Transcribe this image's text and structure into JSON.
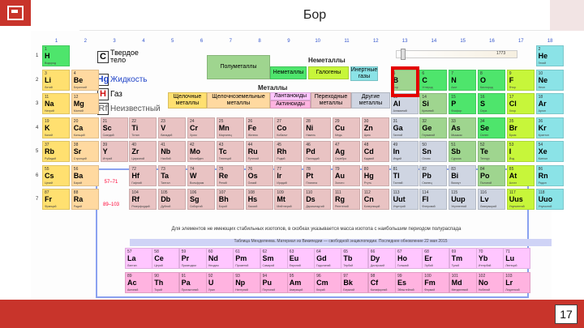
{
  "title": "Бор",
  "page_number": "17",
  "logo_icon": "periodic-chip-icon",
  "highlight_color": "#e40000",
  "slider_value": "1773",
  "state_legend": [
    {
      "symbol": "C",
      "label_line1": "Твердое",
      "label_line2": "тело"
    },
    {
      "symbol": "Hg",
      "label_line1": "Жидкость"
    },
    {
      "symbol": "H",
      "label_line1": "Газ"
    },
    {
      "symbol": "Rf",
      "label_line1": "Неизвестный"
    }
  ],
  "nonmetals_label": "Неметаллы",
  "metals_label": "Металлы",
  "categories": {
    "semimetals": "Полуметаллы",
    "other_nonmetals": "Неметаллы",
    "halogens": "Галогены",
    "noble_gases": "Инертные газы",
    "alkali": "Щелочные металлы",
    "alkaline_earth": "Щелочноземельные металлы",
    "lanthanides": "Лантаноиды",
    "actinides": "Актиноиды",
    "transition": "Переходные металлы",
    "other_metals": "Другие металлы"
  },
  "groups": [
    "1",
    "2",
    "3",
    "4",
    "5",
    "6",
    "7",
    "8",
    "9",
    "10",
    "11",
    "12",
    "13",
    "14",
    "15",
    "16",
    "17",
    "18"
  ],
  "periods": [
    "1",
    "2",
    "3",
    "4",
    "5",
    "6",
    "7"
  ],
  "la_label": "57–71",
  "ac_label": "89–103",
  "note": "Для элементов не имеющих стабильных изотопов, в скобках указывается масса изотопа с наибольшим периодом полураспада",
  "source": "Таблица Менделеева. Материал из Википедии — свободной энциклопедии. Последнее обновление 22 мая 2015",
  "rows": [
    [
      [
        "1",
        "H",
        "Водород"
      ],
      null,
      null,
      null,
      null,
      null,
      null,
      null,
      null,
      null,
      null,
      null,
      null,
      null,
      null,
      null,
      null,
      [
        "2",
        "He",
        "Гелий"
      ]
    ],
    [
      [
        "3",
        "Li",
        "Литий"
      ],
      [
        "4",
        "Be",
        "Бериллий"
      ],
      null,
      null,
      null,
      null,
      null,
      null,
      null,
      null,
      null,
      null,
      [
        "5",
        "B",
        "Бор"
      ],
      [
        "6",
        "C",
        "Углерод"
      ],
      [
        "7",
        "N",
        "Азот"
      ],
      [
        "8",
        "O",
        "Кислород"
      ],
      [
        "9",
        "F",
        "Фтор"
      ],
      [
        "10",
        "Ne",
        "Неон"
      ]
    ],
    [
      [
        "11",
        "Na",
        "Натрий"
      ],
      [
        "12",
        "Mg",
        "Магний"
      ],
      null,
      null,
      null,
      null,
      null,
      null,
      null,
      null,
      null,
      null,
      [
        "13",
        "Al",
        "Алюминий"
      ],
      [
        "14",
        "Si",
        "Кремний"
      ],
      [
        "15",
        "P",
        "Фосфор"
      ],
      [
        "16",
        "S",
        "Сера"
      ],
      [
        "17",
        "Cl",
        "Хлор"
      ],
      [
        "18",
        "Ar",
        "Аргон"
      ]
    ],
    [
      [
        "19",
        "K",
        "Калий"
      ],
      [
        "20",
        "Ca",
        "Кальций"
      ],
      [
        "21",
        "Sc",
        "Скандий"
      ],
      [
        "22",
        "Ti",
        "Титан"
      ],
      [
        "23",
        "V",
        "Ванадий"
      ],
      [
        "24",
        "Cr",
        "Хром"
      ],
      [
        "25",
        "Mn",
        "Марганец"
      ],
      [
        "26",
        "Fe",
        "Железо"
      ],
      [
        "27",
        "Co",
        "Кобальт"
      ],
      [
        "28",
        "Ni",
        "Никель"
      ],
      [
        "29",
        "Cu",
        "Медь"
      ],
      [
        "30",
        "Zn",
        "Цинк"
      ],
      [
        "31",
        "Ga",
        "Галлий"
      ],
      [
        "32",
        "Ge",
        "Германий"
      ],
      [
        "33",
        "As",
        "Мышьяк"
      ],
      [
        "34",
        "Se",
        "Селен"
      ],
      [
        "35",
        "Br",
        "Бром"
      ],
      [
        "36",
        "Kr",
        "Криптон"
      ]
    ],
    [
      [
        "37",
        "Rb",
        "Рубидий"
      ],
      [
        "38",
        "Sr",
        "Стронций"
      ],
      [
        "39",
        "Y",
        "Иттрий"
      ],
      [
        "40",
        "Zr",
        "Цирконий"
      ],
      [
        "41",
        "Nb",
        "Ниобий"
      ],
      [
        "42",
        "Mo",
        "Молибден"
      ],
      [
        "43",
        "Tc",
        "Технеций"
      ],
      [
        "44",
        "Ru",
        "Рутений"
      ],
      [
        "45",
        "Rh",
        "Родий"
      ],
      [
        "46",
        "Pd",
        "Палладий"
      ],
      [
        "47",
        "Ag",
        "Серебро"
      ],
      [
        "48",
        "Cd",
        "Кадмий"
      ],
      [
        "49",
        "In",
        "Индий"
      ],
      [
        "50",
        "Sn",
        "Олово"
      ],
      [
        "51",
        "Sb",
        "Сурьма"
      ],
      [
        "52",
        "Te",
        "Теллур"
      ],
      [
        "53",
        "I",
        "Йод"
      ],
      [
        "54",
        "Xe",
        "Ксенон"
      ]
    ],
    [
      [
        "55",
        "Cs",
        "Цезий"
      ],
      [
        "56",
        "Ba",
        "Барий"
      ],
      null,
      [
        "72",
        "Hf",
        "Гафний"
      ],
      [
        "73",
        "Ta",
        "Тантал"
      ],
      [
        "74",
        "W",
        "Вольфрам"
      ],
      [
        "75",
        "Re",
        "Рений"
      ],
      [
        "76",
        "Os",
        "Осмий"
      ],
      [
        "77",
        "Ir",
        "Иридий"
      ],
      [
        "78",
        "Pt",
        "Платина"
      ],
      [
        "79",
        "Au",
        "Золото"
      ],
      [
        "80",
        "Hg",
        "Ртуть"
      ],
      [
        "81",
        "Tl",
        "Таллий"
      ],
      [
        "82",
        "Pb",
        "Свинец"
      ],
      [
        "83",
        "Bi",
        "Висмут"
      ],
      [
        "84",
        "Po",
        "Полоний"
      ],
      [
        "85",
        "At",
        "Астат"
      ],
      [
        "86",
        "Rn",
        "Радон"
      ]
    ],
    [
      [
        "87",
        "Fr",
        "Франций"
      ],
      [
        "88",
        "Ra",
        "Радий"
      ],
      null,
      [
        "104",
        "Rf",
        "Резерфордий"
      ],
      [
        "105",
        "Db",
        "Дубний"
      ],
      [
        "106",
        "Sg",
        "Сиборгий"
      ],
      [
        "107",
        "Bh",
        "Борий"
      ],
      [
        "108",
        "Hs",
        "Хассий"
      ],
      [
        "109",
        "Mt",
        "Мейтнерий"
      ],
      [
        "110",
        "Ds",
        "Дармштадтий"
      ],
      [
        "111",
        "Rg",
        "Рентгений"
      ],
      [
        "112",
        "Cn",
        "Коперниций"
      ],
      [
        "113",
        "Uut",
        "Унунтрий"
      ],
      [
        "114",
        "Fl",
        "Флеровий"
      ],
      [
        "115",
        "Uup",
        "Унунпентий"
      ],
      [
        "116",
        "Lv",
        "Ливерморий"
      ],
      [
        "117",
        "Uus",
        "Унунсептий"
      ],
      [
        "118",
        "Uuo",
        "Унуноктий"
      ]
    ]
  ],
  "lanthanides": [
    [
      "57",
      "La",
      "Лантан"
    ],
    [
      "58",
      "Ce",
      "Церий"
    ],
    [
      "59",
      "Pr",
      "Празеодим"
    ],
    [
      "60",
      "Nd",
      "Неодим"
    ],
    [
      "61",
      "Pm",
      "Прометий"
    ],
    [
      "62",
      "Sm",
      "Самарий"
    ],
    [
      "63",
      "Eu",
      "Европий"
    ],
    [
      "64",
      "Gd",
      "Гадолиний"
    ],
    [
      "65",
      "Tb",
      "Тербий"
    ],
    [
      "66",
      "Dy",
      "Диспрозий"
    ],
    [
      "67",
      "Ho",
      "Гольмий"
    ],
    [
      "68",
      "Er",
      "Эрбий"
    ],
    [
      "69",
      "Tm",
      "Тулий"
    ],
    [
      "70",
      "Yb",
      "Иттербий"
    ],
    [
      "71",
      "Lu",
      "Лютеций"
    ]
  ],
  "actinides": [
    [
      "89",
      "Ac",
      "Актиний"
    ],
    [
      "90",
      "Th",
      "Торий"
    ],
    [
      "91",
      "Pa",
      "Протактиний"
    ],
    [
      "92",
      "U",
      "Уран"
    ],
    [
      "93",
      "Np",
      "Нептуний"
    ],
    [
      "94",
      "Pu",
      "Плутоний"
    ],
    [
      "95",
      "Am",
      "Америций"
    ],
    [
      "96",
      "Cm",
      "Кюрий"
    ],
    [
      "97",
      "Bk",
      "Берклий"
    ],
    [
      "98",
      "Cf",
      "Калифорний"
    ],
    [
      "99",
      "Es",
      "Эйнштейний"
    ],
    [
      "100",
      "Fm",
      "Фермий"
    ],
    [
      "101",
      "Md",
      "Менделевий"
    ],
    [
      "102",
      "No",
      "Нобелий"
    ],
    [
      "103",
      "Lr",
      "Лоуренсий"
    ]
  ]
}
